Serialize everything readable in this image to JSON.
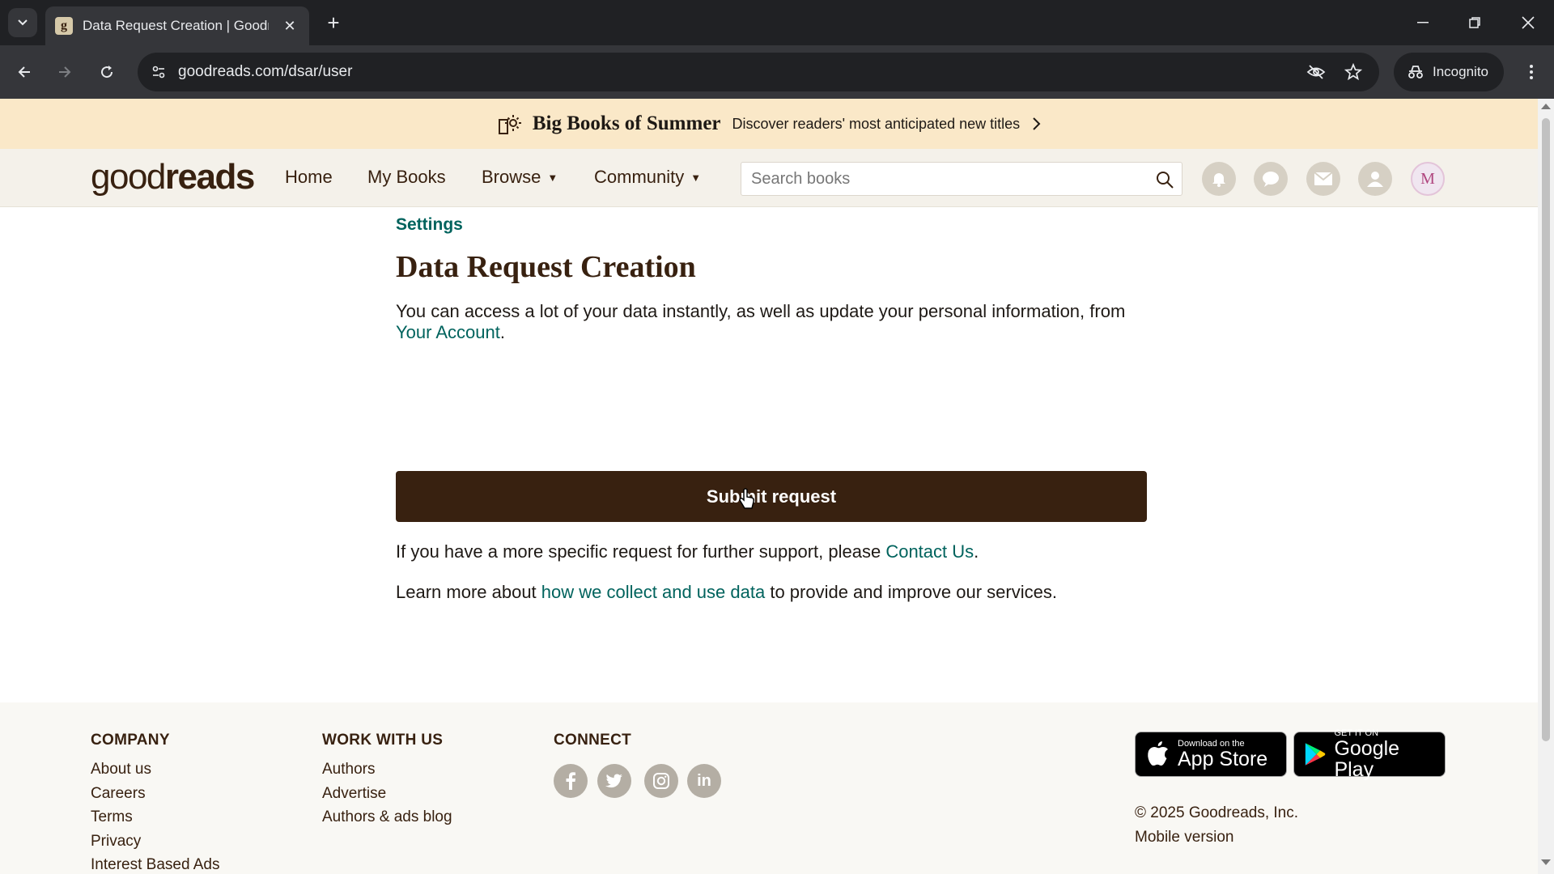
{
  "browser": {
    "tab_title": "Data Request Creation | Goodr",
    "url": "goodreads.com/dsar/user",
    "incognito_label": "Incognito"
  },
  "banner": {
    "title": "Big Books of Summer",
    "subtitle": "Discover readers' most anticipated new titles"
  },
  "header": {
    "logo_light": "good",
    "logo_bold": "reads",
    "nav": {
      "home": "Home",
      "my_books": "My Books",
      "browse": "Browse",
      "community": "Community"
    },
    "search_placeholder": "Search books",
    "avatar_initial": "M"
  },
  "main": {
    "breadcrumb": "Settings",
    "title": "Data Request Creation",
    "intro_text": "You can access a lot of your data instantly, as well as update your personal information, from",
    "intro_link": "Your Account",
    "intro_end": ".",
    "submit_label": "Submit request",
    "support_text": "If you have a more specific request for further support, please",
    "support_link": "Contact Us",
    "support_end": ".",
    "learn_text": "Learn more about",
    "learn_link": "how we collect and use data",
    "learn_end": "to provide and improve our services."
  },
  "footer": {
    "company": {
      "heading": "COMPANY",
      "links": [
        "About us",
        "Careers",
        "Terms",
        "Privacy",
        "Interest Based Ads"
      ]
    },
    "work": {
      "heading": "WORK WITH US",
      "links": [
        "Authors",
        "Advertise",
        "Authors & ads blog"
      ]
    },
    "connect": {
      "heading": "CONNECT"
    },
    "app_store": {
      "small": "Download on the",
      "big": "App Store"
    },
    "google_play": {
      "small": "GET IT ON",
      "big": "Google Play"
    },
    "copyright": "© 2025 Goodreads, Inc.",
    "mobile": "Mobile version"
  },
  "colors": {
    "brand_brown": "#382110",
    "link_green": "#00635d",
    "banner_bg": "#fae8c8",
    "header_bg": "#f4f1ea"
  },
  "icons": [
    "tab-search-icon",
    "close-icon",
    "plus-icon",
    "minimize-icon",
    "restore-icon",
    "back-icon",
    "forward-icon",
    "reload-icon",
    "site-info-icon",
    "eye-off-icon",
    "star-icon",
    "incognito-icon",
    "more-icon",
    "sun-book-icon",
    "chevron-right-icon",
    "search-icon",
    "bell-icon",
    "chat-icon",
    "mail-icon",
    "friends-icon",
    "facebook-icon",
    "twitter-icon",
    "instagram-icon",
    "linkedin-icon",
    "apple-icon",
    "play-icon"
  ]
}
